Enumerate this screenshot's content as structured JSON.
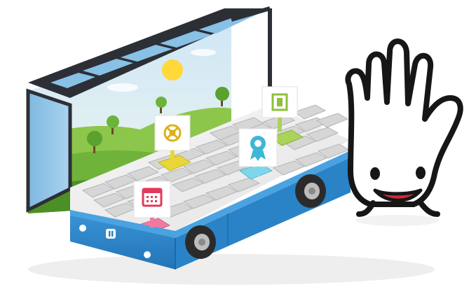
{
  "colors": {
    "background": "#ffffff",
    "bus_blue": "#2e86c9",
    "bus_blue_dark": "#1e6aa8",
    "bus_frame": "#3a3d44",
    "window_glass": "#8fc3e6",
    "sky_top": "#cfe6f6",
    "sky_bottom": "#eaf4ea",
    "grass": "#6fb33a",
    "grass_dark": "#4c8f26",
    "sun": "#ffd83a",
    "tile_grey": "#d8d8d8",
    "tile_yellow": "#e8d63a",
    "tile_cyan": "#7fd6ea",
    "tile_green": "#a9d35a",
    "tile_pink": "#f07aa0",
    "mascot_outline": "#161616",
    "mascot_smile": "#d8283c"
  },
  "icons": {
    "calendar": "calendar-icon",
    "compass": "compass-icon",
    "award": "award-ribbon-icon",
    "film": "film-strip-icon"
  }
}
